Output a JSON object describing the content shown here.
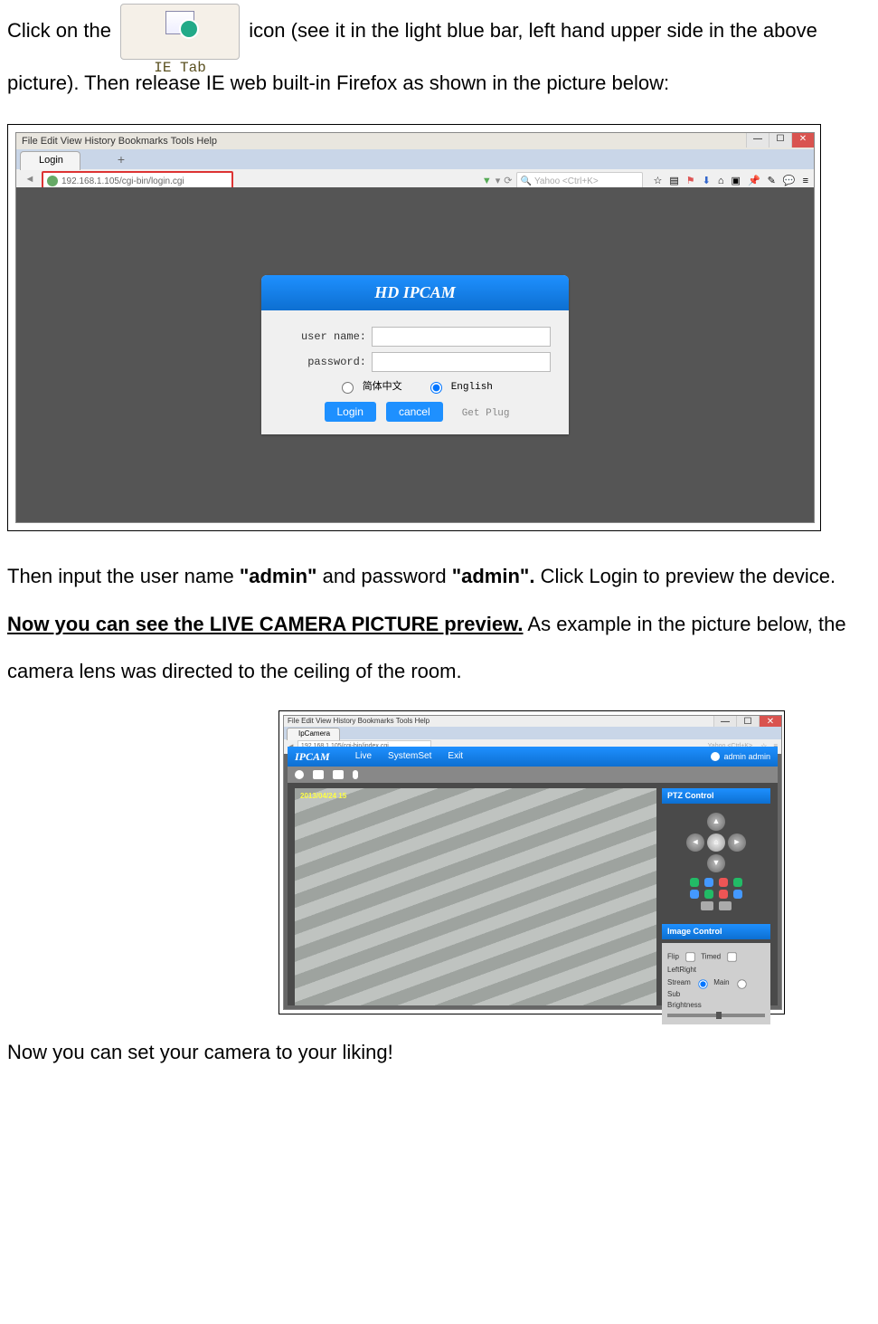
{
  "para1_pre": "Click on the ",
  "ietab_label": "IE Tab",
  "para1_post": " icon (see it in the light blue bar, left hand upper side in the above picture). Then release IE web built-in Firefox as shown in the picture below:",
  "login_shot": {
    "menubar": "File  Edit  View  History  Bookmarks  Tools  Help",
    "tab_title": "Login",
    "url": "192.168.1.105/cgi-bin/login.cgi",
    "search_placeholder": "Yahoo <Ctrl+K>",
    "panel_title": "HD IPCAM",
    "user_label": "user name:",
    "pass_label": "password:",
    "lang_cn": "简体中文",
    "lang_en": "English",
    "login_btn": "Login",
    "cancel_btn": "cancel",
    "get_plug": "Get Plug"
  },
  "para2_a": "Then input the user name ",
  "para2_b": "\"admin\"",
  "para2_c": " and password ",
  "para2_d": "\"admin\".",
  "para2_e": " Click Login to preview the device. ",
  "para2_f": "Now you can see the LIVE CAMERA PICTURE preview.",
  "para2_g": " As example in the picture below, the camera lens was directed to the ceiling of the room.",
  "live_shot": {
    "menubar": "File  Edit  View  History  Bookmarks  Tools  Help",
    "tab_title": "IpCamera",
    "url": "192.168.1.105/cgi-bin/index.cgi",
    "search_placeholder": "Yahoo <Ctrl+K>",
    "brand": "IPCAM",
    "nav_live": "Live",
    "nav_system": "SystemSet",
    "nav_exit": "Exit",
    "user_label": "admin   admin",
    "timestamp": "2013/04/24 15",
    "ptz_title": "PTZ Control",
    "img_title": "Image Control",
    "flip": "Flip",
    "timed": "Timed",
    "leftright": "LeftRight",
    "stream": "Stream",
    "main": "Main",
    "sub": "Sub",
    "brightness": "Brightness"
  },
  "para3": "Now you can set your camera to your liking!"
}
